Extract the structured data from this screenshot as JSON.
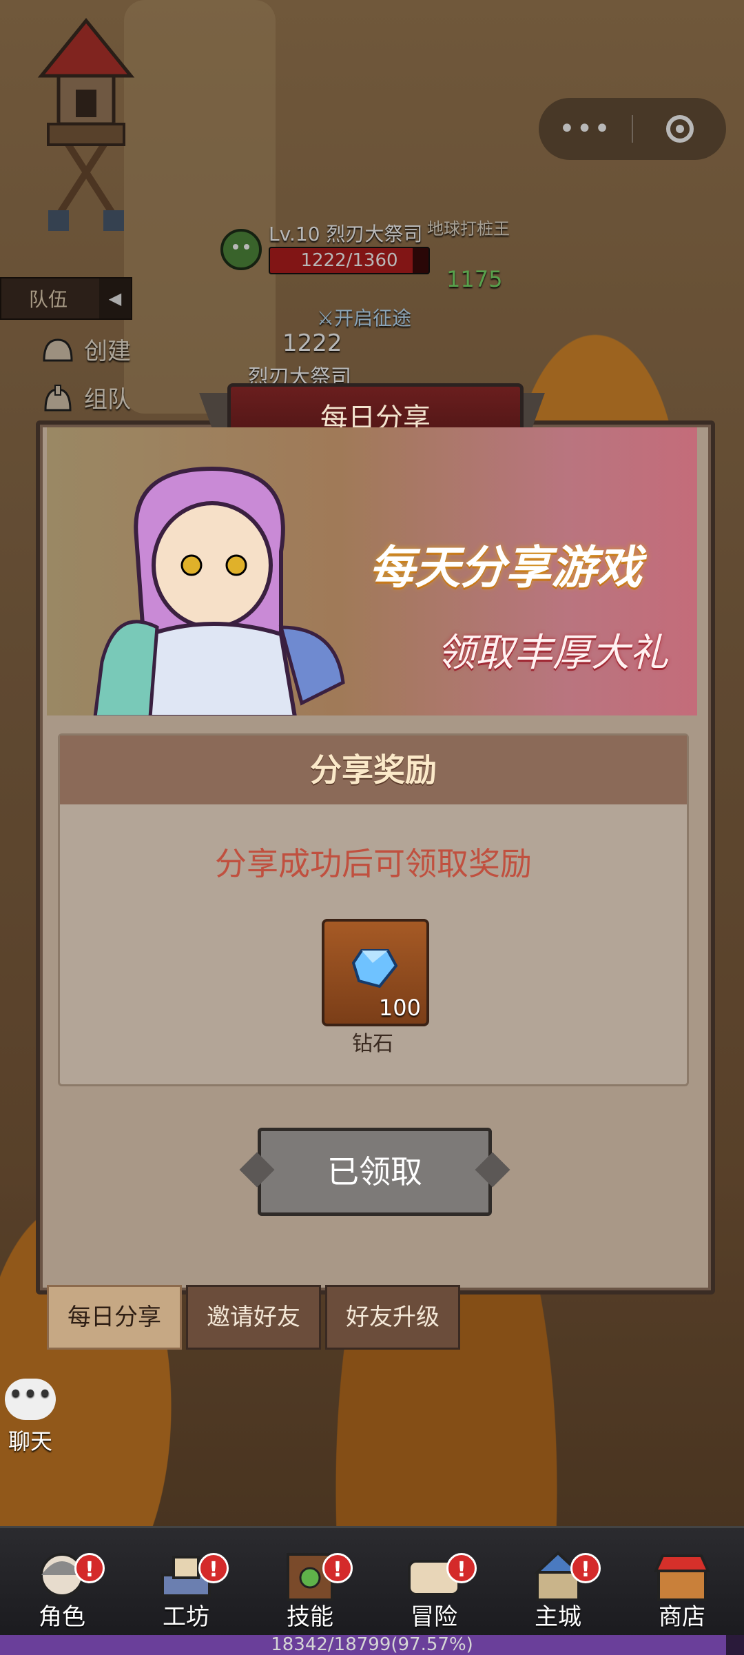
{
  "capsule": {
    "more_icon": "more-dots-icon",
    "close_icon": "target-circle-icon"
  },
  "hud": {
    "team_tab": "队伍",
    "create_label": "创建",
    "group_label": "组队",
    "enemy_name": "Lv.10 烈刃大祭司",
    "enemy_hp": "1222/1360",
    "enemy_hp_fraction": 0.9,
    "player_tag": "地球打桩王",
    "player_power": "1175",
    "expedition_label": "开启征途",
    "damage_text": "1222",
    "enemy_name_short": "烈刃大祭司",
    "chat_label": "聊天"
  },
  "modal": {
    "title": "每日分享",
    "banner_line1": "每天分享游戏",
    "banner_line2": "领取丰厚大礼",
    "reward_header": "分享奖励",
    "reward_tip": "分享成功后可领取奖励",
    "item": {
      "name": "钻石",
      "count": "100",
      "icon": "diamond-icon"
    },
    "claim_button": "已领取"
  },
  "tabs": [
    {
      "label": "每日分享",
      "active": true
    },
    {
      "label": "邀请好友",
      "active": false
    },
    {
      "label": "好友升级",
      "active": false
    }
  ],
  "nav": [
    {
      "label": "角色",
      "icon": "character-icon",
      "badge": "!"
    },
    {
      "label": "工坊",
      "icon": "workshop-icon",
      "badge": "!"
    },
    {
      "label": "技能",
      "icon": "skill-book-icon",
      "badge": "!"
    },
    {
      "label": "冒险",
      "icon": "adventure-scroll-icon",
      "badge": "!"
    },
    {
      "label": "主城",
      "icon": "castle-icon",
      "badge": "!"
    },
    {
      "label": "商店",
      "icon": "shop-icon",
      "badge": ""
    }
  ],
  "xp": {
    "text": "18342/18799(97.57%)",
    "fraction": 0.9757
  },
  "colors": {
    "accent_red": "#d42a2a",
    "reward_tip": "#c0503f",
    "title_plate": "#5a1a1a"
  }
}
